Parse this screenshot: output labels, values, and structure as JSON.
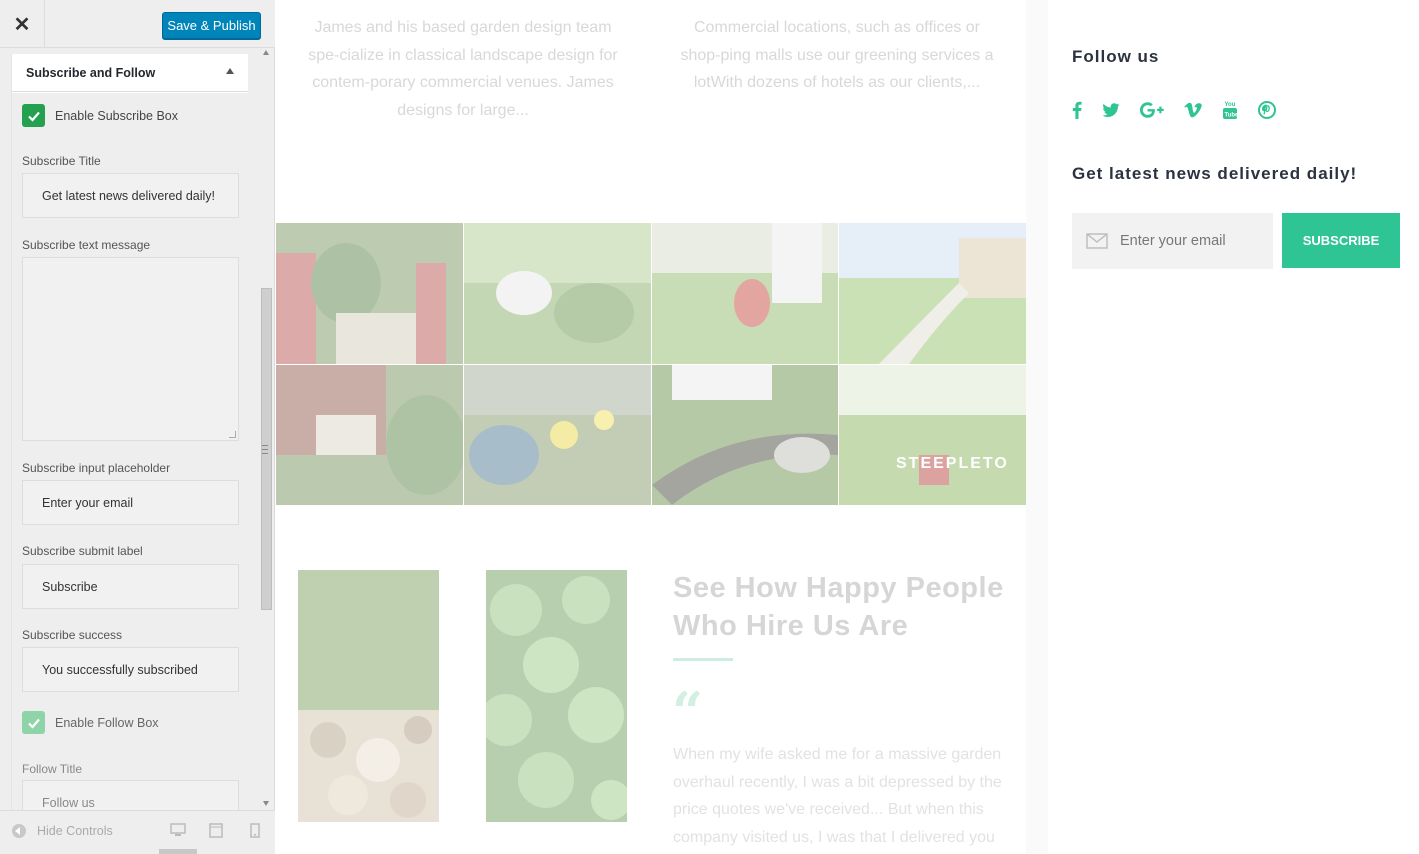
{
  "customizer": {
    "close_label": "✕",
    "publish_label": "Save & Publish",
    "section_title": "Subscribe and Follow",
    "enable_subscribe_label": "Enable Subscribe Box",
    "subscribe_title_label": "Subscribe Title",
    "subscribe_title_value": "Get latest news delivered daily!",
    "subscribe_text_label": "Subscribe text message",
    "subscribe_text_value": "",
    "input_placeholder_label": "Subscribe input placeholder",
    "input_placeholder_value": "Enter your email",
    "submit_label_label": "Subscribe submit label",
    "submit_label_value": "Subscribe",
    "success_label": "Subscribe success",
    "success_value": "You successfully subscribed",
    "enable_follow_label": "Enable Follow Box",
    "follow_title_label": "Follow Title",
    "follow_title_value": "Follow us",
    "hide_controls_label": "Hide Controls",
    "accent_color": "#0085ba",
    "check_color": "#23a050"
  },
  "preview": {
    "excerpt_left": "James and his based garden design team spe-cialize in classical landscape design for contem-porary commercial venues. James designs for large...",
    "excerpt_right": "Commercial locations, such as offices or shop-ping malls use our greening services a lotWith dozens of hotels as our clients,...",
    "gallery_caption": "STEEPLETO",
    "happy_title": "See How Happy People Who Hire Us Are",
    "quote_mark": "“",
    "quote_text": "When my wife asked me for a massive garden overhaul recently, I was a bit depressed by the price quotes we've received... But when this company visited us, I was that I delivered you",
    "follow_title": "Follow us",
    "social_icons": [
      "facebook-icon",
      "twitter-icon",
      "google-plus-icon",
      "vimeo-icon",
      "youtube-icon",
      "pinterest-icon"
    ],
    "news_title": "Get latest news delivered daily!",
    "email_placeholder": "Enter your email",
    "subscribe_button": "SUBSCRIBE",
    "brand_color": "#2ec493"
  }
}
